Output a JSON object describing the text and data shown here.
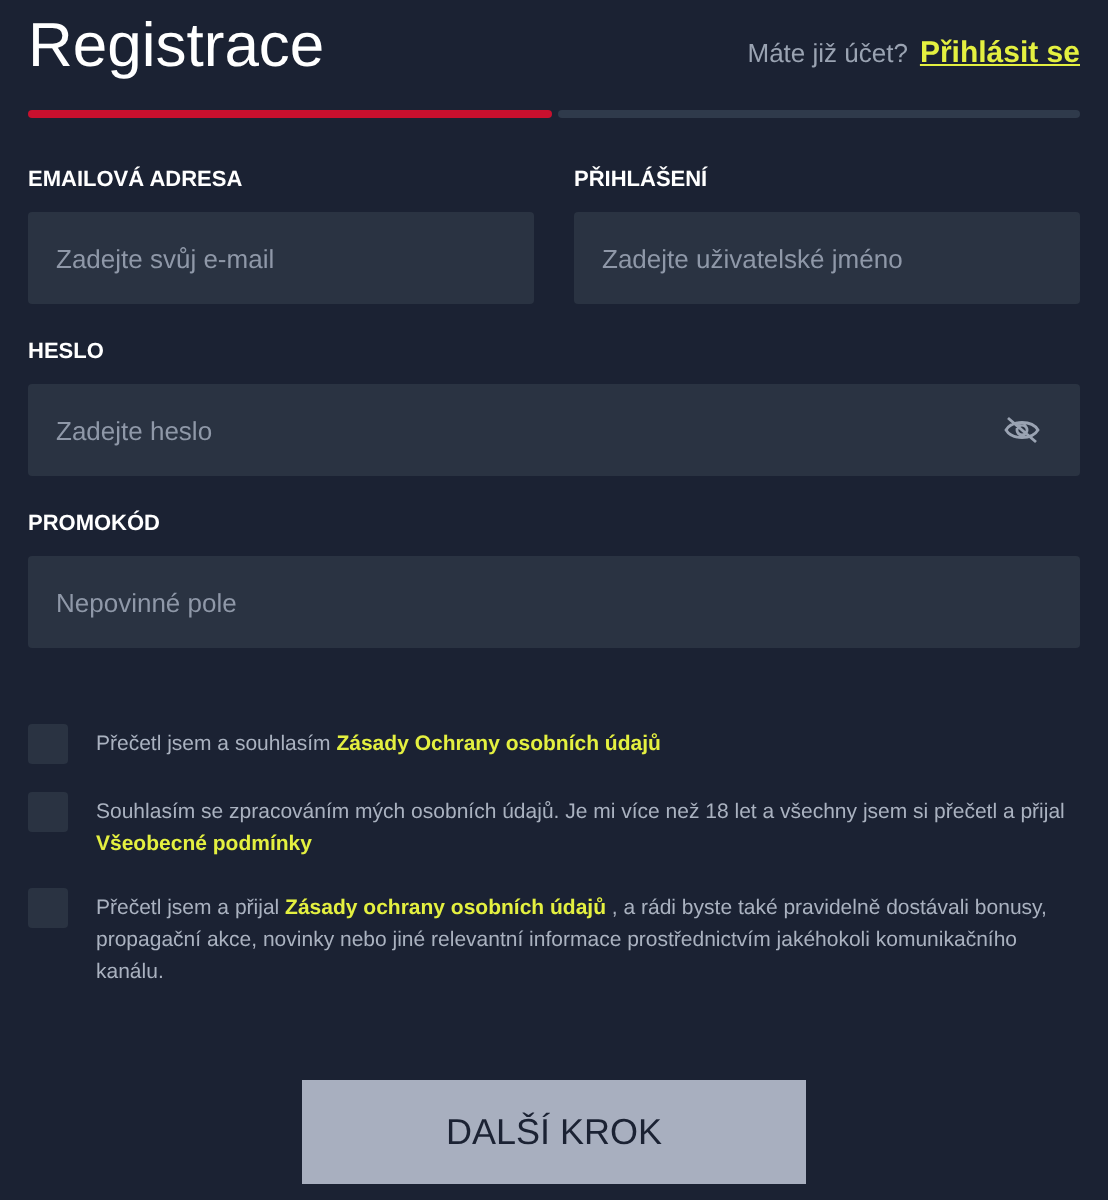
{
  "title": "Registrace",
  "login_prompt": {
    "text": "Máte již účet?",
    "link": "Přihlásit se"
  },
  "steps": [
    {
      "selected": true
    },
    {
      "selected": false
    }
  ],
  "fields": [
    {
      "label": "EMAILOVÁ ADRESA",
      "placeholder": "Zadejte svůj e-mail",
      "kind": "text"
    },
    {
      "label": "PŘIHLÁŠENÍ",
      "placeholder": "Zadejte uživatelské jméno",
      "kind": "text"
    },
    {
      "label": "HESLO",
      "placeholder": "Zadejte heslo",
      "kind": "password"
    },
    {
      "label": "PROMOKÓD",
      "placeholder": "Nepovinné pole",
      "kind": "text"
    }
  ],
  "consents": [
    {
      "checked": false,
      "before": "Přečetl jsem a souhlasím",
      "link": "Zásady Ochrany osobních údajů"
    },
    {
      "checked": false,
      "before": "Souhlasím se zpracováním mých osobních údajů. Je mi více než 18 let a všechny jsem si přečetl a přijal",
      "link": "Všeobecné podmínky"
    },
    {
      "checked": false,
      "before": "Přečetl jsem a přijal",
      "link": "Zásady ochrany osobních údajů",
      "after": ", a rádi byste také pravidelně dostávali bonusy, propagační akce, novinky nebo jiné relevantní informace prostřednictvím jakéhokoli komunikačního kanálu."
    }
  ],
  "submit": "DALŠÍ KROK"
}
